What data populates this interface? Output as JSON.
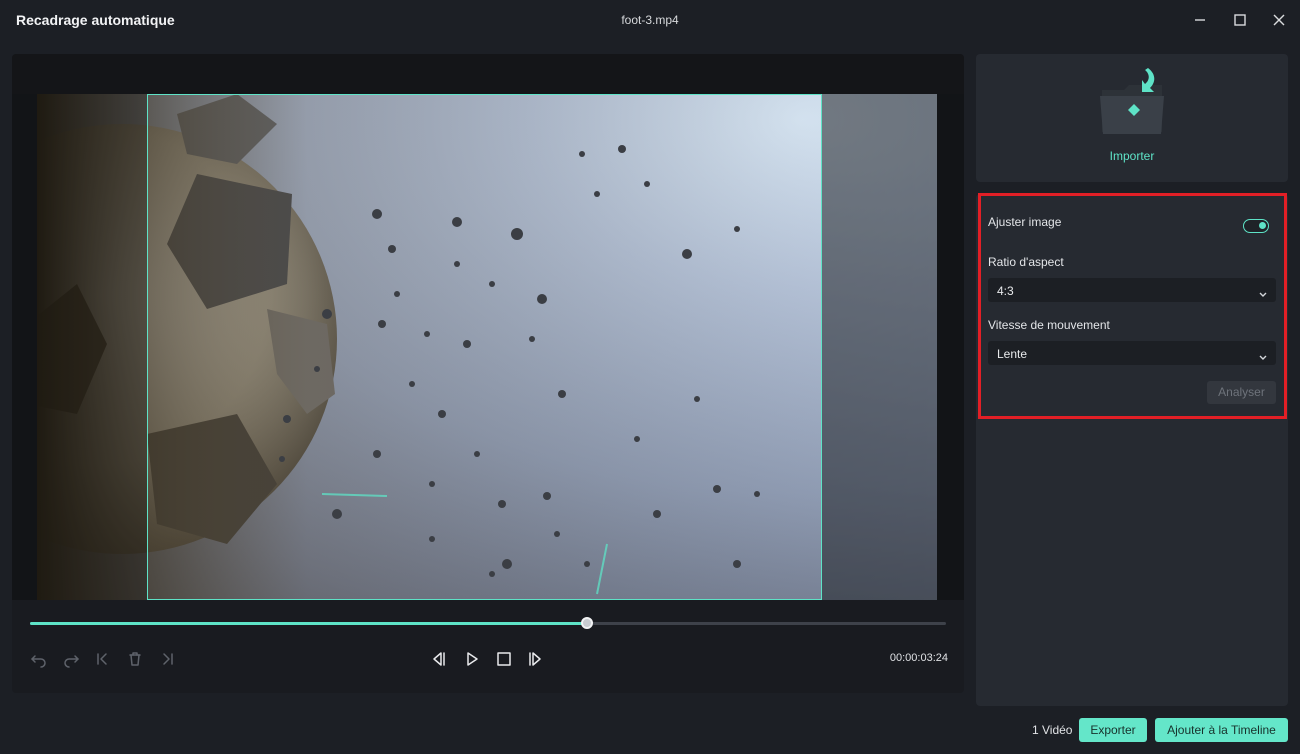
{
  "window": {
    "title": "Recadrage automatique",
    "file_name": "foot-3.mp4"
  },
  "player": {
    "timecode": "00:00:03:24",
    "progress_fraction": 0.608
  },
  "import": {
    "label": "Importer"
  },
  "settings": {
    "fit_image_label": "Ajuster image",
    "fit_image_enabled": true,
    "aspect_ratio_label": "Ratio d'aspect",
    "aspect_ratio_value": "4:3",
    "motion_speed_label": "Vitesse de mouvement",
    "motion_speed_value": "Lente",
    "analyse_label": "Analyser"
  },
  "footer": {
    "video_count": "1 Vidéo",
    "export_label": "Exporter",
    "add_timeline_label": "Ajouter à la Timeline"
  },
  "colors": {
    "accent": "#5ee3c7",
    "highlight": "#e21f26",
    "background": "#1c1f25"
  }
}
